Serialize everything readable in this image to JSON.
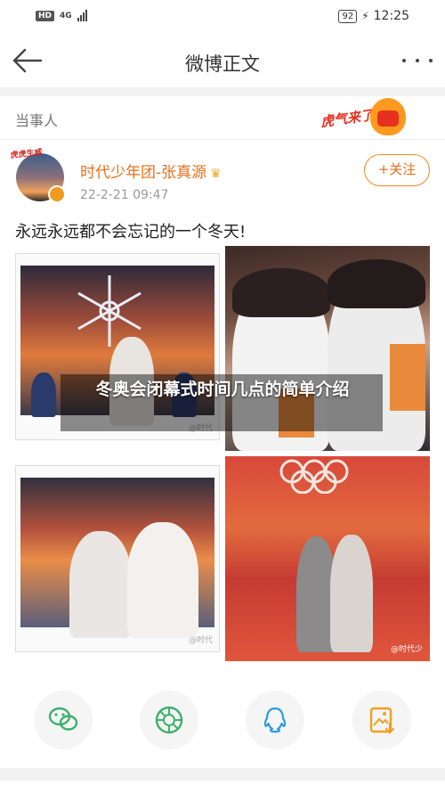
{
  "status_bar": {
    "network_badge": "HD",
    "network_type": "4G",
    "battery": "92",
    "time": "12:25"
  },
  "topbar": {
    "title": "微博正文"
  },
  "section": {
    "label": "当事人",
    "sticker_text": "虎气来了"
  },
  "post": {
    "avatar_hat_text": "虎虎生威",
    "author": "时代少年团-张真源",
    "time": "22-2-21 09:47",
    "follow_label": "+关注",
    "text": "永远永远都不会忘记的一个冬天!",
    "photos": [
      {
        "watermark": "@时代"
      },
      {
        "watermark": ""
      },
      {
        "watermark": "@时代"
      },
      {
        "watermark": "@时代少"
      }
    ]
  },
  "overlay": {
    "text": "冬奥会闭幕式时间几点的简单介绍"
  },
  "share": {
    "items": [
      {
        "icon": "wechat-icon",
        "color": "#3db16b"
      },
      {
        "icon": "moments-icon",
        "color": "#3db16b"
      },
      {
        "icon": "qq-icon",
        "color": "#2a9be0"
      },
      {
        "icon": "save-image-icon",
        "color": "#f0a020"
      }
    ]
  }
}
